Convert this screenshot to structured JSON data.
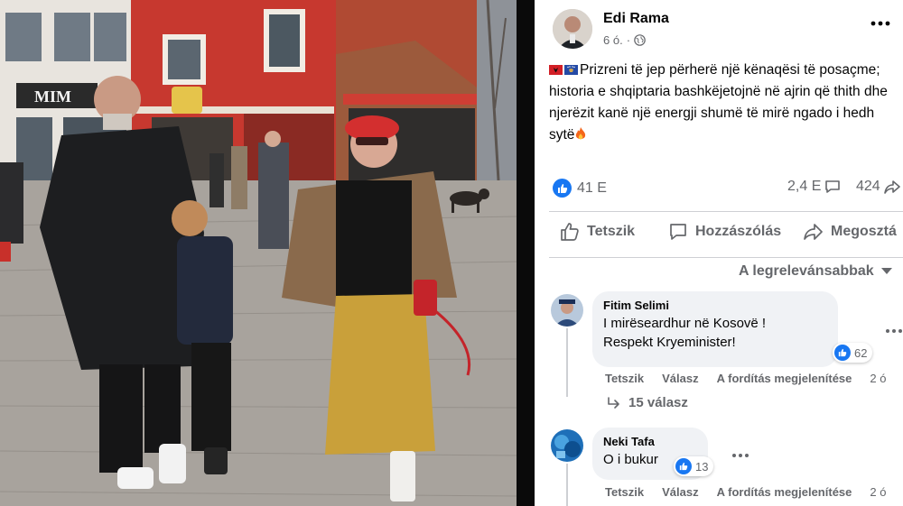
{
  "post": {
    "author": "Edi Rama",
    "time": "6 ó.",
    "more_icon": "more-horizontal-icon",
    "text_main": "Prizreni të jep përherë një kënaqësi të posaçme; historia e shqiptaria bashkëjetojnë në ajrin që thith dhe njerëzit kanë një energji shumë të mirë ngado i hedh sytë",
    "reactions_count": "41 E",
    "comments_count": "2,4 E",
    "shares_count": "424"
  },
  "actions": {
    "like_label": "Tetszik",
    "comment_label": "Hozzászólás",
    "share_label": "Megosztá"
  },
  "sort": {
    "label": "A legrelevánsabbak"
  },
  "comments": [
    {
      "name": "Fitim Selimi",
      "line1": "I mirëseardhur në Kosovë !",
      "line2": "Respekt Kryeminister!",
      "reactions": "62",
      "like": "Tetszik",
      "reply": "Válasz",
      "translate": "A fordítás megjelenítése",
      "time": "2 ó",
      "replies": "15 válasz"
    },
    {
      "name": "Neki Tafa",
      "line1": "O i bukur",
      "reactions": "13",
      "like": "Tetszik",
      "reply": "Válasz",
      "translate": "A fordítás megjelenítése",
      "time": "2 ó"
    }
  ],
  "colors": {
    "brand_blue": "#1877f2",
    "secondary_text": "#65676b",
    "bubble_bg": "#f0f2f5",
    "divider": "#ced0d4"
  },
  "photo": {
    "shop_sign": "MIM"
  }
}
